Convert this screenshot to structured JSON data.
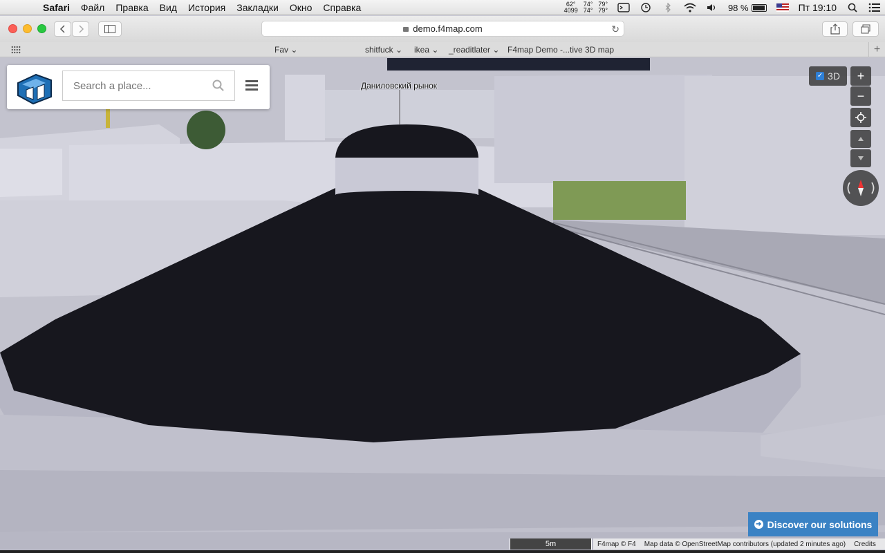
{
  "menubar": {
    "app_name": "Safari",
    "items": [
      "Файл",
      "Правка",
      "Вид",
      "История",
      "Закладки",
      "Окно",
      "Справка"
    ],
    "stats": {
      "a1": "62°",
      "a2": "4099",
      "b1": "74°",
      "b2": "74°",
      "c1": "79°",
      "c2": "79°"
    },
    "battery": "98 %",
    "clock": "Пт 19:10"
  },
  "browser": {
    "url": "demo.f4map.com",
    "bookmarks": [
      "Fav",
      "shitfuck",
      "ikea",
      "_readitlater",
      "F4map Demo -...tive 3D map"
    ]
  },
  "map": {
    "search_placeholder": "Search a place...",
    "place_label": "Даниловский рынок",
    "toggle_3d_label": "3D",
    "zoom_in": "+",
    "zoom_out": "−",
    "discover_label": "Discover our solutions",
    "scale_label": "5m",
    "attribution": {
      "f4": "F4map © F4",
      "osm": "Map data © OpenStreetMap contributors (updated 2 minutes ago)",
      "credits": "Credits"
    }
  },
  "colors": {
    "roof": "#17171e",
    "building": "#c8c8d4",
    "accent": "#3a82c4",
    "grass": "#7f9a55"
  }
}
